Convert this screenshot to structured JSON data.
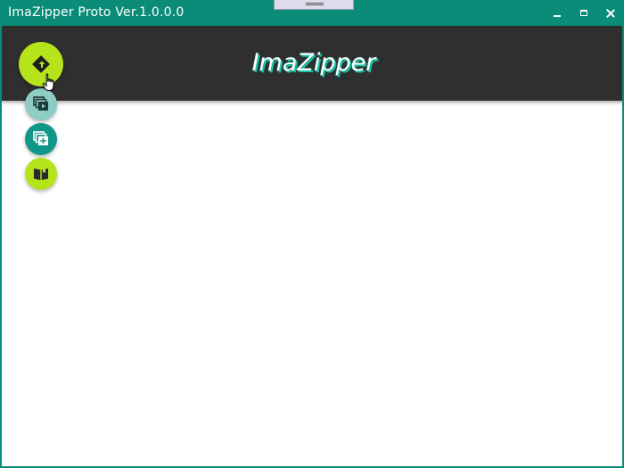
{
  "window": {
    "title": "ImaZipper Proto Ver.1.0.0.0"
  },
  "appbar": {
    "brand": "ImaZipper"
  },
  "colors": {
    "titlebar": "#0a8c78",
    "appbar": "#2f2f2f",
    "accent_lime": "#b6e41a",
    "accent_teal_light": "#8dcdc6",
    "accent_teal_dark": "#11978a",
    "brand_shadow": "#13c4a8"
  },
  "fab_menu": {
    "main": {
      "icon": "diamond-arrow-icon"
    },
    "items": [
      {
        "icon": "image-stack-play-icon"
      },
      {
        "icon": "image-stack-add-icon"
      },
      {
        "icon": "open-book-icon"
      }
    ]
  },
  "window_controls": [
    "minimize-icon",
    "maximize-icon",
    "close-icon"
  ]
}
